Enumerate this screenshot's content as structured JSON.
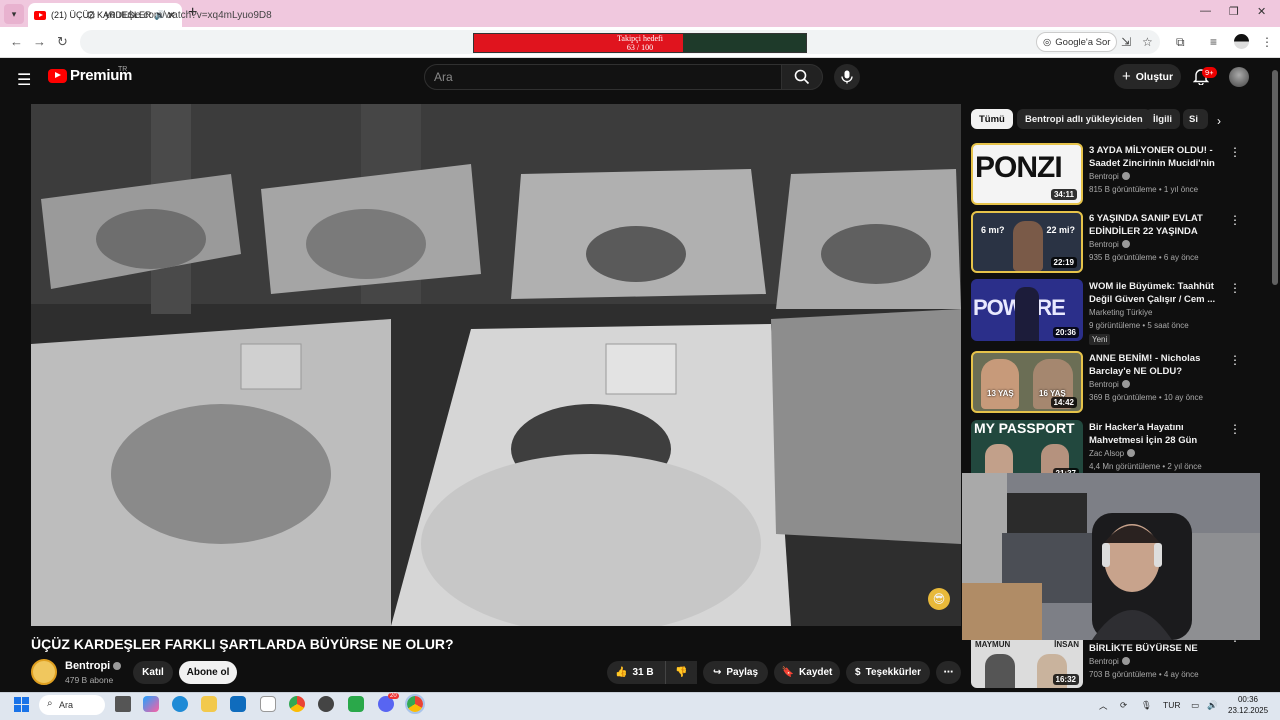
{
  "browser": {
    "tab_title": "(21) ÜÇÜZ KARDEŞLER FARKLI",
    "url": "youtube.com/watch?v=xq4mLyuo9D8",
    "google_sor": "Google'a Sor"
  },
  "overlay_goal": {
    "title": "Takipçi hedefi",
    "progress_text": "63 / 100",
    "current": 63,
    "target": 100,
    "fill_color": "#e0141e"
  },
  "yt_header": {
    "logo_text": "Premium",
    "country": "TR",
    "search_placeholder": "Ara",
    "create_label": "Oluştur",
    "notifications_badge": "9+"
  },
  "video": {
    "title": "ÜÇÜZ KARDEŞLER FARKLI ŞARTLARDA BÜYÜRSE NE OLUR?",
    "channel": "Bentropi",
    "subscribers": "479 B abone",
    "join_label": "Katıl",
    "subscribe_label": "Abone ol",
    "likes": "31 B",
    "share_label": "Paylaş",
    "save_label": "Kaydet",
    "thanks_label": "Teşekkürler"
  },
  "chips": [
    "Tümü",
    "Bentropi adlı yükleyiciden",
    "İlgili",
    "Si"
  ],
  "recommendations": [
    {
      "title": "3 AYDA MİLYONER OLDU! - Saadet Zincirinin Mucidi'nin ...",
      "channel": "Bentropi",
      "meta": "815 B görüntüleme • 1 yıl önce",
      "duration": "34:11",
      "thumb_text": "PONZI"
    },
    {
      "title": "6 YAŞINDA SANIP EVLAT EDİNDİLER 22 YAŞINDA ÇIKTI",
      "channel": "Bentropi",
      "meta": "935 B görüntüleme • 6 ay önce",
      "duration": "22:19",
      "thumb_left": "6 mı?",
      "thumb_right": "22 mi?"
    },
    {
      "title": "WOM ile Büyümek: Taahhüt Değil Güven Çalışır / Cem ...",
      "channel": "Marketing Türkiye",
      "meta": "9 görüntüleme • 5 saat önce",
      "duration": "20:36",
      "badge": "Yeni",
      "thumb_text": "POWERE"
    },
    {
      "title": "ANNE BENİM! - Nicholas Barclay'e NE OLDU?",
      "channel": "Bentropi",
      "meta": "369 B görüntüleme • 10 ay önce",
      "duration": "14:42",
      "thumb_left": "13 YAŞ",
      "thumb_right": "16 YAŞ"
    },
    {
      "title": "Bir Hacker'a Hayatını Mahvetmesi İçin 28 Gün Verdim",
      "channel": "Zac Alsop",
      "meta": "4,4 Mn görüntüleme • 2 yıl önce",
      "duration": "21:37",
      "thumb_text": "MY PASSPORT"
    },
    {
      "title": "MAYMUN VE İNSAN BİRLİKTE BÜYÜRSE NE OLUR?",
      "channel": "Bentropi",
      "meta": "703 B görüntüleme • 4 ay önce",
      "duration": "16:32",
      "thumb_left": "MAYMUN",
      "thumb_right": "İNSAN"
    }
  ],
  "taskbar": {
    "search_label": "Ara",
    "language": "TUR",
    "time": "00:36",
    "date": "23.12.2025",
    "discord_badge": "20"
  }
}
